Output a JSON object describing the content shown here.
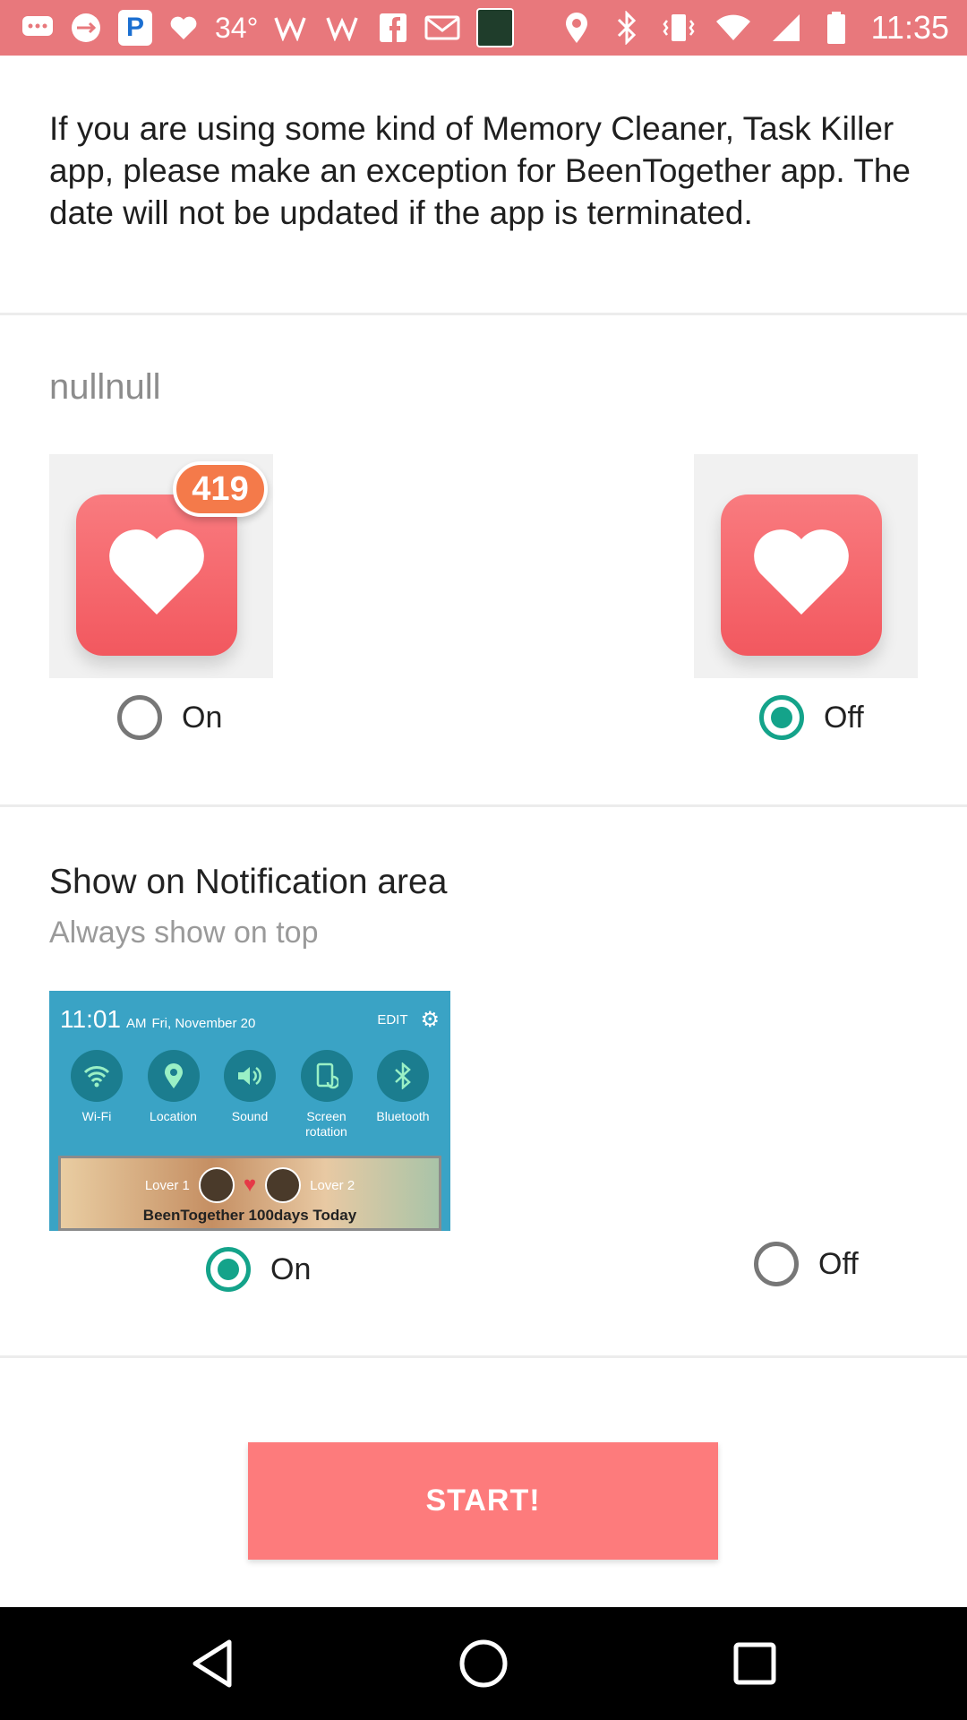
{
  "status_bar": {
    "temperature": "34°",
    "time": "11:35",
    "p_badge": "P",
    "left_icons": [
      "chat-icon",
      "usb-icon",
      "p-app-icon",
      "heart-icon",
      "temperature-icon",
      "w-icon",
      "w-icon",
      "facebook-icon",
      "gmail-icon",
      "bible-icon"
    ],
    "right_icons": [
      "location-icon",
      "bluetooth-icon",
      "vibrate-icon",
      "wifi-icon",
      "signal-icon",
      "battery-icon"
    ]
  },
  "intro_text": "If you are using some kind of Memory Cleaner, Task Killer app, please make an exception for BeenTogether app. The date will not be updated if the app is terminated.",
  "names": "nullnull",
  "widget_options": {
    "badge_count": "419",
    "on_label": "On",
    "off_label": "Off",
    "selected": "off"
  },
  "notification": {
    "title": "Show on Notification area",
    "subtitle": "Always show on top",
    "preview": {
      "time": "11:01",
      "am": "AM",
      "date": "Fri, November 20",
      "edit": "EDIT",
      "toggles": [
        {
          "label": "Wi-Fi",
          "icon": "wifi-icon"
        },
        {
          "label": "Location",
          "icon": "location-icon"
        },
        {
          "label": "Sound",
          "icon": "sound-icon"
        },
        {
          "label": "Screen rotation",
          "icon": "rotation-icon"
        },
        {
          "label": "Bluetooth",
          "icon": "bluetooth-icon"
        }
      ],
      "lover1": "Lover 1",
      "lover2": "Lover 2",
      "banner_text": "BeenTogether 100days Today"
    },
    "on_label": "On",
    "off_label": "Off",
    "selected": "on"
  },
  "start_button": "START!",
  "colors": {
    "status_bar": "#e8787c",
    "accent": "#14a38a",
    "heart": "#f2585f",
    "badge": "#f47a4a",
    "button": "#fd7b7c"
  }
}
